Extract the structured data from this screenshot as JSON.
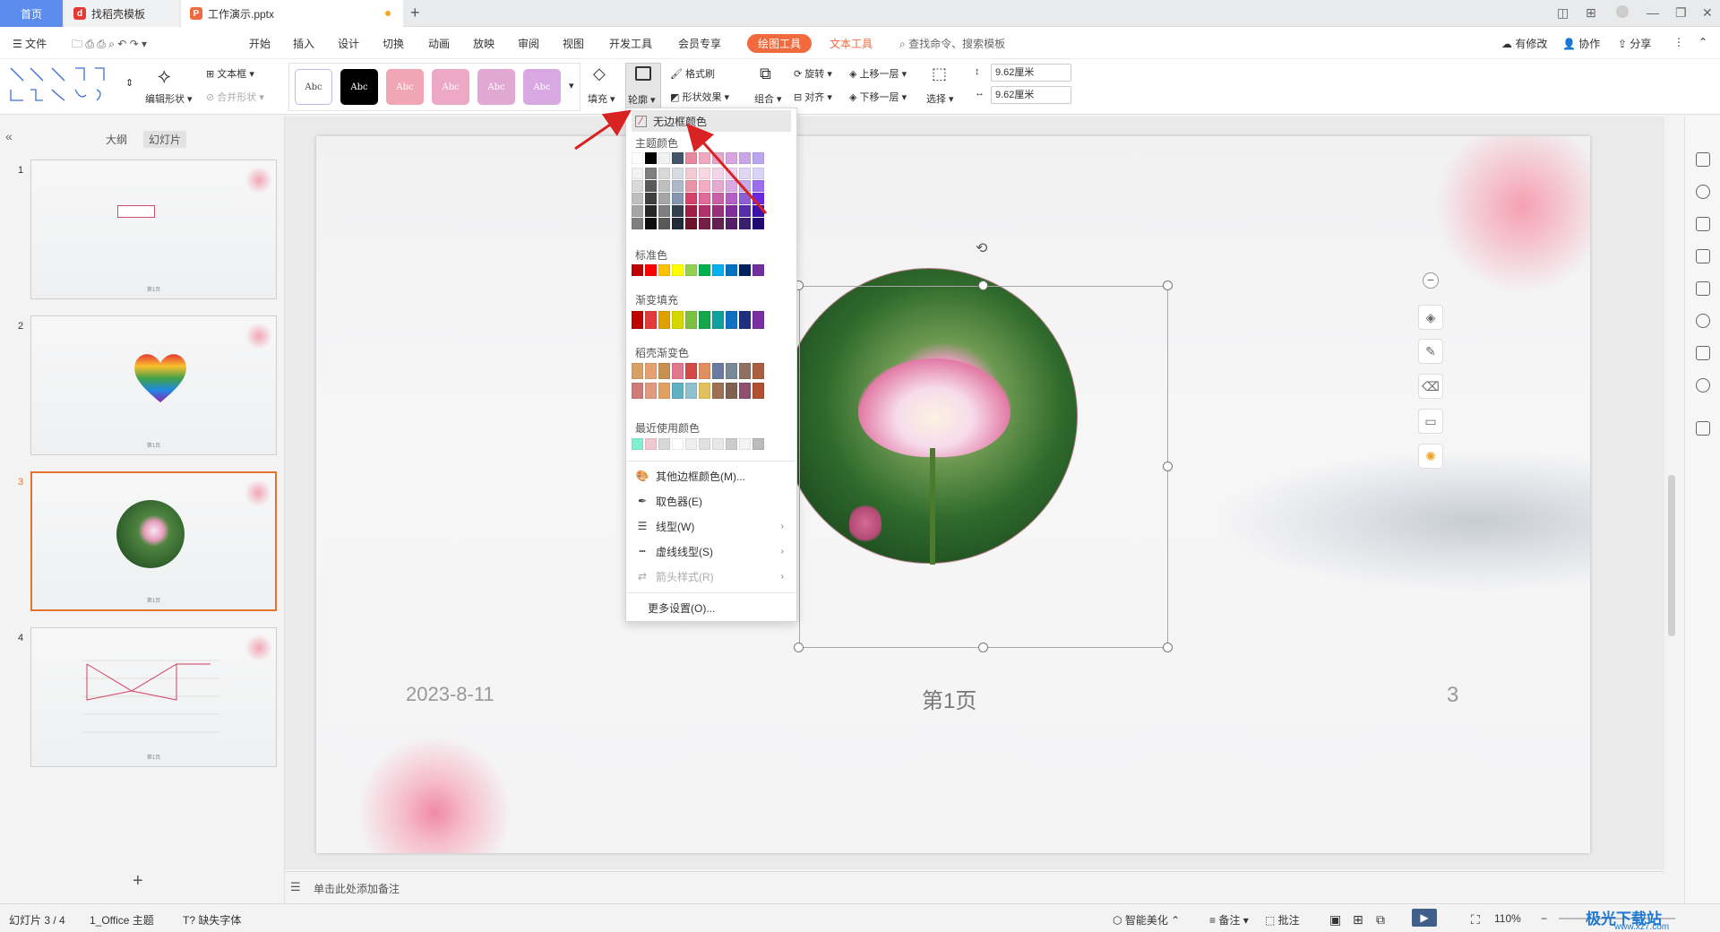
{
  "tabs": {
    "home": "首页",
    "template": "找稻壳模板",
    "doc": "工作演示.pptx"
  },
  "ribbon_tabs": {
    "file": "文件",
    "start": "开始",
    "insert": "插入",
    "design": "设计",
    "transition": "切换",
    "animation": "动画",
    "slideshow": "放映",
    "review": "审阅",
    "view": "视图",
    "dev": "开发工具",
    "vip": "会员专享",
    "draw": "绘图工具",
    "text": "文本工具",
    "search": "查找命令、搜索模板",
    "changes": "有修改",
    "collab": "协作",
    "share": "分享"
  },
  "toolbar": {
    "edit_shape": "编辑形状",
    "textbox": "文本框",
    "merge_shape": "合并形状",
    "style_sample": "Abc",
    "fill": "填充",
    "outline": "轮廓",
    "format_painter": "格式刷",
    "shape_effect": "形状效果",
    "group": "组合",
    "rotate": "旋转",
    "align": "对齐",
    "bring_forward": "上移一层",
    "send_backward": "下移一层",
    "select": "选择",
    "height": "9.62厘米",
    "width": "9.62厘米"
  },
  "left_panel": {
    "outline_tab": "大纲",
    "slides_tab": "幻灯片",
    "add": "+",
    "thumb_foot": "第1页"
  },
  "slides": [
    {
      "num": "1"
    },
    {
      "num": "2"
    },
    {
      "num": "3"
    },
    {
      "num": "4"
    }
  ],
  "slide": {
    "date": "2023-8-11",
    "page_label": "第1页",
    "page_num": "3"
  },
  "dropdown": {
    "no_border": "无边框颜色",
    "theme_colors": "主题颜色",
    "standard_colors": "标准色",
    "gradient_fill": "渐变填充",
    "docer_gradient": "稻壳渐变色",
    "recent_colors": "最近使用颜色",
    "more_border_colors": "其他边框颜色(M)...",
    "eyedropper": "取色器(E)",
    "line_type": "线型(W)",
    "dash_type": "虚线线型(S)",
    "arrow_style": "箭头样式(R)",
    "more_settings": "更多设置(O)...",
    "theme_top_row": [
      "#ffffff",
      "#000000",
      "#f2f2f2",
      "#44546a",
      "#e8889e",
      "#f0a8c0",
      "#e6a6cf",
      "#d9a6e0",
      "#c9a6ea",
      "#b9a6f0"
    ],
    "standard_row": [
      "#c00000",
      "#ff0000",
      "#ffc000",
      "#ffff00",
      "#92d050",
      "#00b050",
      "#00b0f0",
      "#0070c0",
      "#002060",
      "#7030a0"
    ],
    "gradient_row": [
      "#c00000",
      "#e23b3b",
      "#e0a000",
      "#d6d600",
      "#7cc040",
      "#14a84a",
      "#10a0a0",
      "#1070c0",
      "#203080",
      "#7a30a0"
    ],
    "docer_row1": [
      "#d9a066",
      "#e4a070",
      "#c89050",
      "#e07890",
      "#d44848",
      "#e09060",
      "#6a7aa0",
      "#7a8898",
      "#907060",
      "#a86040"
    ],
    "docer_row2": [
      "#d07a7a",
      "#e09a80",
      "#e0a060",
      "#60b0c0",
      "#90c0d0",
      "#e0c060",
      "#a07050",
      "#806050",
      "#905070",
      "#b05030"
    ],
    "recent_row": [
      "#80f0d0",
      "#f0c8d0",
      "#d8d8d8",
      "#ffffff",
      "#eeeeee",
      "#e0e0e0",
      "#e8e8e8",
      "#cccccc",
      "#f4f4f4",
      "#bbbbbb"
    ]
  },
  "notes": {
    "add_note": "单击此处添加备注"
  },
  "status": {
    "slide_count": "幻灯片 3 / 4",
    "theme": "1_Office 主题",
    "missing_font": "缺失字体",
    "smart_beautify": "智能美化",
    "notes": "备注",
    "comment": "批注",
    "zoom": "110%"
  },
  "watermark": {
    "site": "极光下载站",
    "url": "www.xz7.com"
  },
  "colors": {
    "accent": "#f06a3e",
    "home_tab": "#5b8def",
    "annotation_arrow": "#d92323"
  }
}
